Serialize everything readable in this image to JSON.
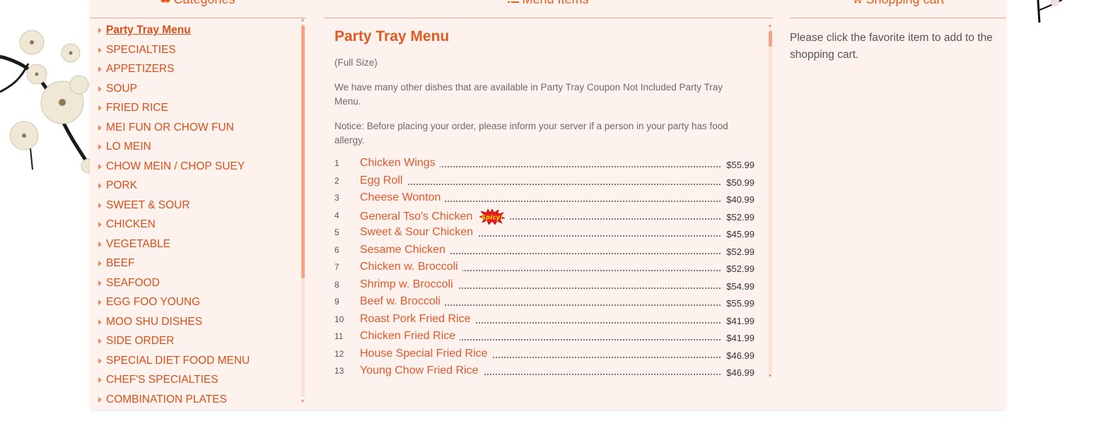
{
  "headers": {
    "categories": "Categories",
    "menu_items": "Menu Items",
    "shopping_cart": "Shopping cart"
  },
  "categories": [
    "Party Tray Menu",
    "SPECIALTIES",
    "APPETIZERS",
    "SOUP",
    "FRIED RICE",
    "MEI FUN OR CHOW FUN",
    "LO MEIN",
    "CHOW MEIN / CHOP SUEY",
    "PORK",
    "SWEET & SOUR",
    "CHICKEN",
    "VEGETABLE",
    "BEEF",
    "SEAFOOD",
    "EGG FOO YOUNG",
    "MOO SHU DISHES",
    "SIDE ORDER",
    "SPECIAL DIET FOOD MENU",
    "CHEF'S SPECIALTIES",
    "COMBINATION PLATES"
  ],
  "active_category": "Party Tray Menu",
  "menu": {
    "title": "Party Tray Menu",
    "subtitle": "(Full Size)",
    "note1": "We have many other dishes that are available in Party Tray Coupon Not Included Party Tray Menu.",
    "note2": "Notice: Before placing your order, please inform your server if a person in your party has food allergy.",
    "spicy_badge": "Spicy!",
    "items": [
      {
        "no": "1",
        "name": "Chicken Wings",
        "price": "$55.99",
        "spicy": false
      },
      {
        "no": "2",
        "name": "Egg Roll",
        "price": "$50.99",
        "spicy": false
      },
      {
        "no": "3",
        "name": "Cheese Wonton",
        "price": "$40.99",
        "spicy": false
      },
      {
        "no": "4",
        "name": "General Tso's Chicken",
        "price": "$52.99",
        "spicy": true
      },
      {
        "no": "5",
        "name": "Sweet & Sour Chicken",
        "price": "$45.99",
        "spicy": false
      },
      {
        "no": "6",
        "name": "Sesame Chicken",
        "price": "$52.99",
        "spicy": false
      },
      {
        "no": "7",
        "name": "Chicken w. Broccoli",
        "price": "$52.99",
        "spicy": false
      },
      {
        "no": "8",
        "name": "Shrimp w. Broccoli",
        "price": "$54.99",
        "spicy": false
      },
      {
        "no": "9",
        "name": "Beef w. Broccoli",
        "price": "$55.99",
        "spicy": false
      },
      {
        "no": "10",
        "name": "Roast Pork Fried Rice",
        "price": "$41.99",
        "spicy": false
      },
      {
        "no": "11",
        "name": "Chicken Fried Rice",
        "price": "$41.99",
        "spicy": false
      },
      {
        "no": "12",
        "name": "House Special Fried Rice",
        "price": "$46.99",
        "spicy": false
      },
      {
        "no": "13",
        "name": "Young Chow Fried Rice",
        "price": "$46.99",
        "spicy": false
      }
    ]
  },
  "cart": {
    "message": "Please click the favorite item to add to the shopping cart."
  },
  "colors": {
    "accent": "#e15a23",
    "panel_bg": "#fdf2ee",
    "divider": "#e8a789"
  }
}
